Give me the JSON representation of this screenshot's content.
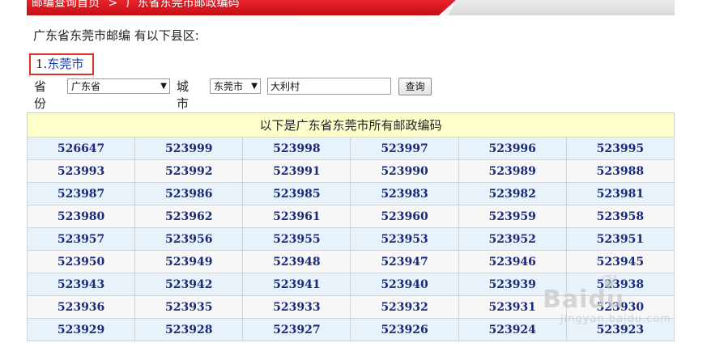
{
  "breadcrumb": {
    "home": "邮编查询首页",
    "separator": ">",
    "current": "广东省东莞市邮政编码"
  },
  "intro_text": "广东省东莞市邮编 有以下县区:",
  "county_list": [
    {
      "index": "1.",
      "name": "东莞市"
    }
  ],
  "search_form": {
    "province_label": "省份",
    "province_value": "广东省",
    "city_label": "城市",
    "city_value": "东莞市",
    "keyword_value": "大利村",
    "query_button": "查询"
  },
  "table": {
    "header": "以下是广东省东莞市所有邮政编码",
    "rows": [
      [
        "526647",
        "523999",
        "523998",
        "523997",
        "523996",
        "523995"
      ],
      [
        "523993",
        "523992",
        "523991",
        "523990",
        "523989",
        "523988"
      ],
      [
        "523987",
        "523986",
        "523985",
        "523983",
        "523982",
        "523981"
      ],
      [
        "523980",
        "523962",
        "523961",
        "523960",
        "523959",
        "523958"
      ],
      [
        "523957",
        "523956",
        "523955",
        "523953",
        "523952",
        "523951"
      ],
      [
        "523950",
        "523949",
        "523948",
        "523947",
        "523946",
        "523945"
      ],
      [
        "523943",
        "523942",
        "523941",
        "523940",
        "523939",
        "523938"
      ],
      [
        "523936",
        "523935",
        "523933",
        "523932",
        "523931",
        "523930"
      ],
      [
        "523929",
        "523928",
        "523927",
        "523926",
        "523924",
        "523923"
      ]
    ]
  },
  "watermark": {
    "brand": "Baidu",
    "sub": "jingyan.baidu.com",
    "icon": "paw-icon"
  },
  "colors": {
    "header_red": "#d41a20",
    "link_blue": "#1a3aa8",
    "code_blue": "#1a2a7a",
    "table_header_bg": "#ffffcc",
    "row_blue": "#e8f2fb",
    "row_gray": "#f7f7f7",
    "highlight_box": "#d9342b"
  }
}
